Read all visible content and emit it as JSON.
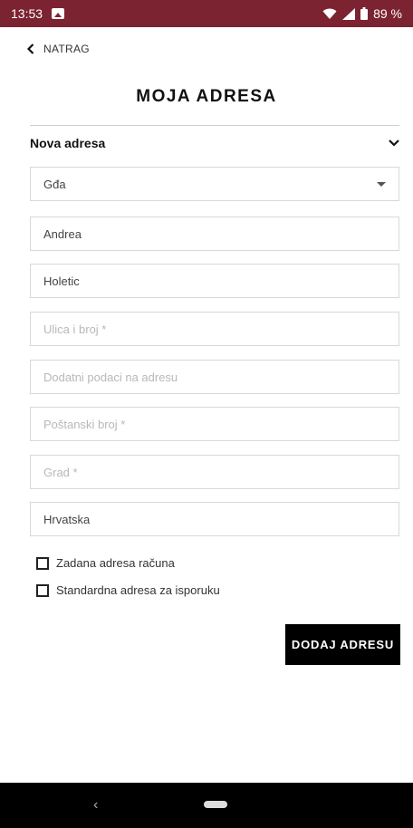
{
  "status_bar": {
    "time": "13:53",
    "battery": "89 %",
    "icons": [
      "image-icon",
      "wifi-icon",
      "signal-icon",
      "battery-icon"
    ]
  },
  "nav": {
    "back_label": "NATRAG"
  },
  "page": {
    "title": "MOJA ADRESA"
  },
  "section": {
    "title": "Nova adresa"
  },
  "form": {
    "salutation": {
      "value": "Gđa"
    },
    "first_name": {
      "value": "Andrea"
    },
    "last_name": {
      "value": "Holetic"
    },
    "street": {
      "value": "",
      "placeholder": "Ulica i broj *"
    },
    "additional": {
      "value": "",
      "placeholder": "Dodatni podaci na adresu"
    },
    "postal_code": {
      "value": "",
      "placeholder": "Poštanski broj *"
    },
    "city": {
      "value": "",
      "placeholder": "Grad *"
    },
    "country": {
      "value": "Hrvatska"
    },
    "checkbox_billing": {
      "label": "Zadana adresa računa",
      "checked": false
    },
    "checkbox_shipping": {
      "label": "Standardna adresa za isporuku",
      "checked": false
    },
    "submit_label": "DODAJ ADRESU"
  },
  "colors": {
    "status_bar": "#7b2331",
    "button": "#000000",
    "nav_bar": "#000000"
  }
}
